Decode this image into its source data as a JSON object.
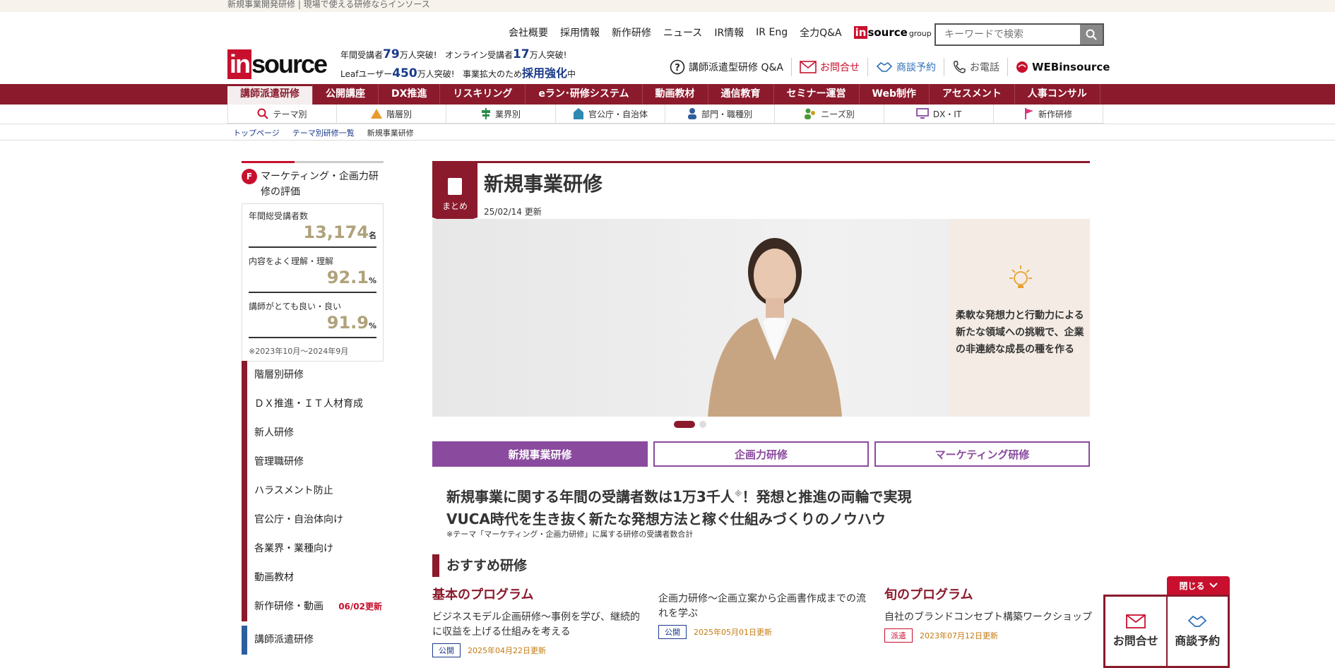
{
  "topbar": {
    "title": "新規事業開発研修 | 現場で使える研修ならインソース"
  },
  "utilnav": [
    "会社概要",
    "採用情報",
    "新作研修",
    "ニュース",
    "IR情報",
    "IR Eng",
    "全力Q&A"
  ],
  "group": {
    "logo_in": "in",
    "logo_source": "source",
    "suffix": "group"
  },
  "search": {
    "placeholder": "キーワードで検索"
  },
  "logo": {
    "in": "in",
    "source": "source"
  },
  "stats": {
    "line1_a": "年間受講者",
    "line1_num1": "79",
    "line1_b": "万人突破!",
    "line1_c": "オンライン受講者",
    "line1_num2": "17",
    "line1_d": "万人突破!",
    "line2_a": "Leafユーザー",
    "line2_num": "450",
    "line2_b": "万人突破!",
    "line2_c": "事業拡大のため",
    "line2_strong": "採用強化",
    "line2_d": "中"
  },
  "contactnav": [
    "講師派遣型研修 Q&A",
    "お問合せ",
    "商談予約",
    "お電話",
    "WEBinsource"
  ],
  "mainnav": [
    "講師派遣研修",
    "公開講座",
    "DX推進",
    "リスキリング",
    "eラン･研修システム",
    "動画教材",
    "通信教育",
    "セミナー運営",
    "Web制作",
    "アセスメント",
    "人事コンサル"
  ],
  "subnav": [
    "テーマ別",
    "階層別",
    "業界別",
    "官公庁・自治体",
    "部門・職種別",
    "ニーズ別",
    "DX・IT",
    "新作研修"
  ],
  "breadcrumb": [
    "トップページ",
    "テーマ別研修一覧",
    "新規事業研修"
  ],
  "eval": {
    "icon_letter": "F",
    "title": "マーケティング・企画力研修の評価",
    "rows": [
      {
        "label": "年間総受講者数",
        "value": "13,174",
        "unit": "名"
      },
      {
        "label": "内容をよく理解・理解",
        "value": "92.1",
        "unit": "%"
      },
      {
        "label": "講師がとても良い・良い",
        "value": "91.9",
        "unit": "%"
      }
    ],
    "note": "※2023年10月～2024年9月"
  },
  "sidemenu": {
    "items": [
      "階層別研修",
      "ＤＸ推進・ＩＴ人材育成",
      "新人研修",
      "管理職研修",
      "ハラスメント防止",
      "官公庁・自治体向け",
      "各業界・業種向け",
      "動画教材",
      "新作研修・動画"
    ],
    "update": "06/02更新",
    "blue_item": "講師派遣研修"
  },
  "page": {
    "badge": "まとめ",
    "title": "新規事業研修",
    "updated": "25/02/14 更新",
    "hero_text": "柔軟な発想力と行動力による新たな領域への挑戦で、企業の非連続な成長の種を作る"
  },
  "tabs": [
    "新規事業研修",
    "企画力研修",
    "マーケティング研修"
  ],
  "lead": {
    "line1": "新規事業に関する年間の受講者数は1万3千人",
    "mark": "※",
    "line1_end": "！発想と推進の両輪で実現",
    "line2": "VUCA時代を生き抜く新たな発想方法と稼ぐ仕組みづくりのノウハウ",
    "note": "※テーマ「マーケティング・企画力研修」に属する研修の受講者数合計"
  },
  "reco": {
    "title": "おすすめ研修"
  },
  "programs": [
    {
      "heading": "基本のプログラム",
      "text": "ビジネスモデル企画研修～事例を学び、継続的に収益を上げる仕組みを考える",
      "tag": "公開",
      "date": "2025年04月22日更新"
    },
    {
      "heading": "",
      "text": "企画力研修～企画立案から企画書作成までの流れを学ぶ",
      "tag": "公開",
      "date": "2025年05月01日更新"
    },
    {
      "heading": "旬のプログラム",
      "text": "自社のブランドコンセプト構築ワークショップ",
      "tag": "派遣",
      "date": "2023年07月12日更新"
    }
  ],
  "float": {
    "close": "閉じる",
    "contact": "お問合せ",
    "booking": "商談予約"
  }
}
